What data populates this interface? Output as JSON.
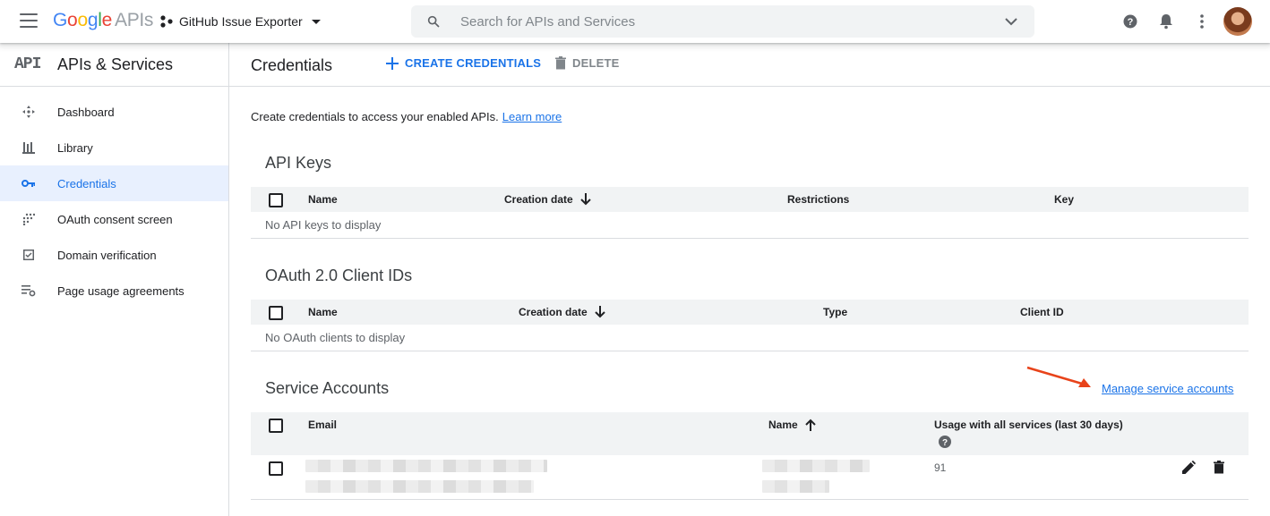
{
  "topbar": {
    "logo_letters": [
      "G",
      "o",
      "o",
      "g",
      "l",
      "e"
    ],
    "logo_suffix": "APIs",
    "project_name": "GitHub Issue Exporter",
    "search_placeholder": "Search for APIs and Services",
    "icons": [
      "hamburger-menu-icon",
      "project-dots-icon",
      "search-icon",
      "chevron-down-icon",
      "help-icon",
      "notifications-icon",
      "more-vert-icon"
    ]
  },
  "sidebar": {
    "mark": "API",
    "title": "APIs & Services",
    "items": [
      {
        "label": "Dashboard",
        "icon": "dashboard-icon",
        "active": false
      },
      {
        "label": "Library",
        "icon": "library-icon",
        "active": false
      },
      {
        "label": "Credentials",
        "icon": "key-icon",
        "active": true
      },
      {
        "label": "OAuth consent screen",
        "icon": "oauth-icon",
        "active": false
      },
      {
        "label": "Domain verification",
        "icon": "checkbox-icon",
        "active": false
      },
      {
        "label": "Page usage agreements",
        "icon": "settings-list-icon",
        "active": false
      }
    ]
  },
  "main": {
    "title": "Credentials",
    "create_label": "CREATE CREDENTIALS",
    "delete_label": "DELETE",
    "intro_text": "Create credentials to access your enabled APIs.",
    "learn_more": "Learn more",
    "api_keys": {
      "title": "API Keys",
      "columns": [
        "Name",
        "Creation date",
        "Restrictions",
        "Key"
      ],
      "empty": "No API keys to display"
    },
    "oauth": {
      "title": "OAuth 2.0 Client IDs",
      "columns": [
        "Name",
        "Creation date",
        "Type",
        "Client ID"
      ],
      "empty": "No OAuth clients to display"
    },
    "service_accounts": {
      "title": "Service Accounts",
      "manage_link": "Manage service accounts",
      "columns": [
        "Email",
        "Name",
        "Usage with all services (last 30 days)"
      ],
      "rows": [
        {
          "usage": "91"
        }
      ]
    }
  },
  "colors": {
    "accent": "#1a73e8",
    "active_bg": "#e8f0fe",
    "header_bg": "#f1f3f4",
    "annotation_arrow": "#e8431a"
  }
}
